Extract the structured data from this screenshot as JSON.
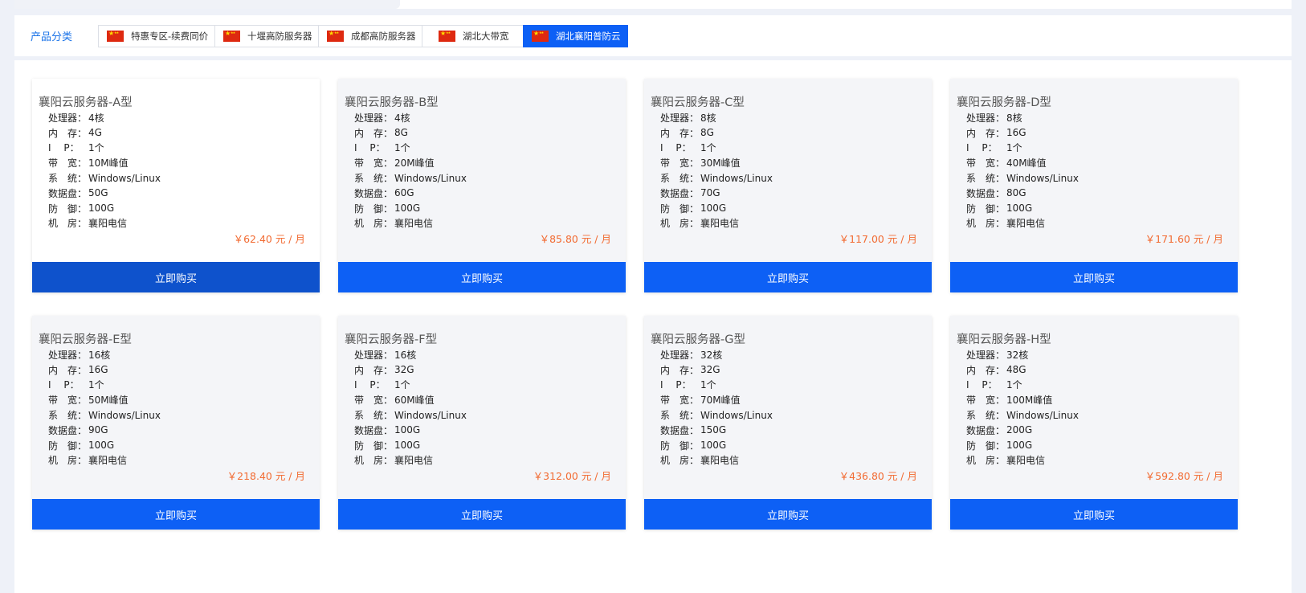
{
  "category_bar": {
    "label": "产品分类",
    "tabs": [
      {
        "label": "特惠专区-续费同价",
        "active": false,
        "icon": "china-flag-icon"
      },
      {
        "label": "十堰高防服务器",
        "active": false,
        "icon": "china-flag-icon"
      },
      {
        "label": "成都高防服务器",
        "active": false,
        "icon": "china-flag-icon"
      },
      {
        "label": "湖北大带宽",
        "active": false,
        "icon": "china-flag-icon"
      },
      {
        "label": "湖北襄阳普防云",
        "active": true,
        "icon": "china-flag-icon"
      }
    ]
  },
  "colors": {
    "accent": "#0d60f5",
    "price": "#f26b32",
    "category_label": "#1a73e8"
  },
  "spec_labels": {
    "cpu": "处理器：",
    "memory": "内　存：",
    "ip": "I　 P：",
    "bandwidth": "带　宽：",
    "os": "系　统：",
    "disk": "数据盘：",
    "defense": "防　御：",
    "datacenter": "机　房："
  },
  "products": [
    {
      "title": "襄阳云服务器-A型",
      "cpu": "4核",
      "memory": "4G",
      "ip": "1个",
      "bandwidth": "10M峰值",
      "os": "Windows/Linux",
      "disk": "50G",
      "defense": "100G",
      "datacenter": "襄阳电信",
      "price": "￥62.40 元 / 月",
      "buy_label": "立即购买"
    },
    {
      "title": "襄阳云服务器-B型",
      "cpu": "4核",
      "memory": "8G",
      "ip": "1个",
      "bandwidth": "20M峰值",
      "os": "Windows/Linux",
      "disk": "60G",
      "defense": "100G",
      "datacenter": "襄阳电信",
      "price": "￥85.80 元 / 月",
      "buy_label": "立即购买"
    },
    {
      "title": "襄阳云服务器-C型",
      "cpu": "8核",
      "memory": "8G",
      "ip": "1个",
      "bandwidth": "30M峰值",
      "os": "Windows/Linux",
      "disk": "70G",
      "defense": "100G",
      "datacenter": "襄阳电信",
      "price": "￥117.00 元 / 月",
      "buy_label": "立即购买"
    },
    {
      "title": "襄阳云服务器-D型",
      "cpu": "8核",
      "memory": "16G",
      "ip": "1个",
      "bandwidth": "40M峰值",
      "os": "Windows/Linux",
      "disk": "80G",
      "defense": "100G",
      "datacenter": "襄阳电信",
      "price": "￥171.60 元 / 月",
      "buy_label": "立即购买"
    },
    {
      "title": "襄阳云服务器-E型",
      "cpu": "16核",
      "memory": "16G",
      "ip": "1个",
      "bandwidth": "50M峰值",
      "os": "Windows/Linux",
      "disk": "90G",
      "defense": "100G",
      "datacenter": "襄阳电信",
      "price": "￥218.40 元 / 月",
      "buy_label": "立即购买"
    },
    {
      "title": "襄阳云服务器-F型",
      "cpu": "16核",
      "memory": "32G",
      "ip": "1个",
      "bandwidth": "60M峰值",
      "os": "Windows/Linux",
      "disk": "100G",
      "defense": "100G",
      "datacenter": "襄阳电信",
      "price": "￥312.00 元 / 月",
      "buy_label": "立即购买"
    },
    {
      "title": "襄阳云服务器-G型",
      "cpu": "32核",
      "memory": "32G",
      "ip": "1个",
      "bandwidth": "70M峰值",
      "os": "Windows/Linux",
      "disk": "150G",
      "defense": "100G",
      "datacenter": "襄阳电信",
      "price": "￥436.80 元 / 月",
      "buy_label": "立即购买"
    },
    {
      "title": "襄阳云服务器-H型",
      "cpu": "32核",
      "memory": "48G",
      "ip": "1个",
      "bandwidth": "100M峰值",
      "os": "Windows/Linux",
      "disk": "200G",
      "defense": "100G",
      "datacenter": "襄阳电信",
      "price": "￥592.80 元 / 月",
      "buy_label": "立即购买"
    }
  ]
}
